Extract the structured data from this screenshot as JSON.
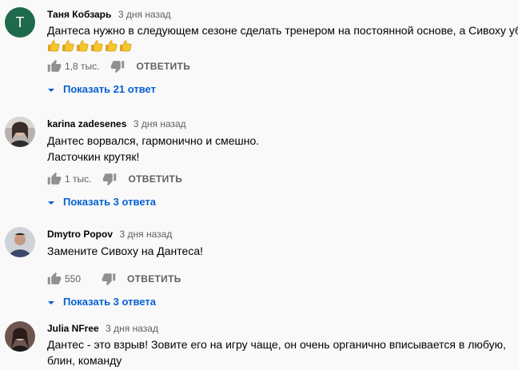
{
  "comments": [
    {
      "avatar_letter": "T",
      "author": "Таня Кобзарь",
      "time": "3 дня назад",
      "text": "Дантеса нужно в следующем сезоне сделать тренером на постоянной основе, а Сивоху убрать",
      "emoji": [
        "thumbs-up",
        "thumbs-up",
        "thumbs-up",
        "thumbs-up",
        "thumbs-up",
        "thumbs-up"
      ],
      "likes": "1,8 тыс.",
      "reply_label": "ОТВЕТИТЬ",
      "replies_label": "Показать 21 ответ"
    },
    {
      "author": "karina zadesenes",
      "time": "3 дня назад",
      "text_line1": "Дантес ворвался, гармонично и смешно.",
      "text_line2": "Ласточкин крутяк!",
      "likes": "1 тыс.",
      "reply_label": "ОТВЕТИТЬ",
      "replies_label": "Показать 3 ответа"
    },
    {
      "author": "Dmytro Popov",
      "time": "3 дня назад",
      "text": "Замените Сивоху на Дантеса!",
      "likes": "550",
      "reply_label": "ОТВЕТИТЬ",
      "replies_label": "Показать 3 ответа"
    },
    {
      "author": "Julia NFree",
      "time": "3 дня назад",
      "text": "Дантес - это взрыв! Зовите его на игру чаще, он очень органично вписывается в любую, блин, команду"
    }
  ],
  "colors": {
    "avatar_bg": "#1e6a4c",
    "link_blue": "#065fd4",
    "secondary_text": "#606060"
  }
}
